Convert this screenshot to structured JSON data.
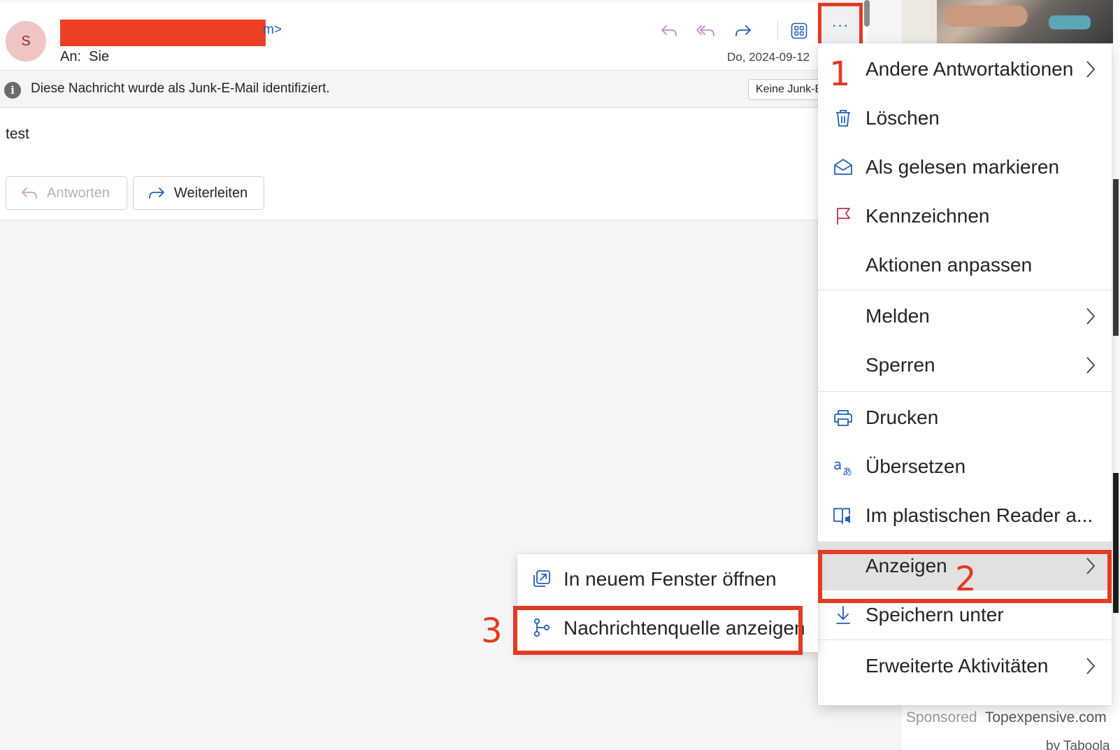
{
  "ad": {
    "sponsored_label": "Sponsored",
    "advertiser": "Topexpensive.com",
    "by_label": "by Taboola"
  },
  "message": {
    "avatar_initial": "S",
    "sender_tail": "m>",
    "to_label": "An:",
    "to_value": "Sie",
    "date": "Do, 2024-09-12",
    "junk_notice": "Diese Nachricht wurde als Junk-E-Mail identifiziert.",
    "not_junk_button": "Keine Junk-E-Mail",
    "body": "test",
    "reply_button": "Antworten",
    "forward_button": "Weiterleiten",
    "more_button": "···"
  },
  "menu": {
    "items": [
      {
        "label": "Andere Antwortaktionen",
        "icon": "none",
        "submenu": true
      },
      {
        "label": "Löschen",
        "icon": "trash-icon"
      },
      {
        "label": "Als gelesen markieren",
        "icon": "envelope-open-icon"
      },
      {
        "label": "Kennzeichnen",
        "icon": "flag-icon"
      },
      {
        "label": "Aktionen anpassen",
        "icon": "none"
      },
      {
        "label": "Melden",
        "icon": "none",
        "submenu": true
      },
      {
        "label": "Sperren",
        "icon": "none",
        "submenu": true
      },
      {
        "label": "Drucken",
        "icon": "printer-icon"
      },
      {
        "label": "Übersetzen",
        "icon": "translate-icon"
      },
      {
        "label": "Im plastischen Reader a...",
        "icon": "immersive-reader-icon"
      },
      {
        "label": "Anzeigen",
        "icon": "none",
        "submenu": true,
        "active": true
      },
      {
        "label": "Speichern unter",
        "icon": "download-icon"
      },
      {
        "label": "Erweiterte Aktivitäten",
        "icon": "none",
        "submenu": true
      }
    ]
  },
  "submenu": {
    "items": [
      {
        "label": "In neuem Fenster öffnen",
        "icon": "open-new-window-icon"
      },
      {
        "label": "Nachrichtenquelle anzeigen",
        "icon": "message-source-icon"
      }
    ]
  },
  "annotations": {
    "step1": "1",
    "step2": "2",
    "step3": "3"
  },
  "colors": {
    "accent": "#1f5fb8",
    "annotation": "#e33a22",
    "flag": "#c4314b"
  }
}
